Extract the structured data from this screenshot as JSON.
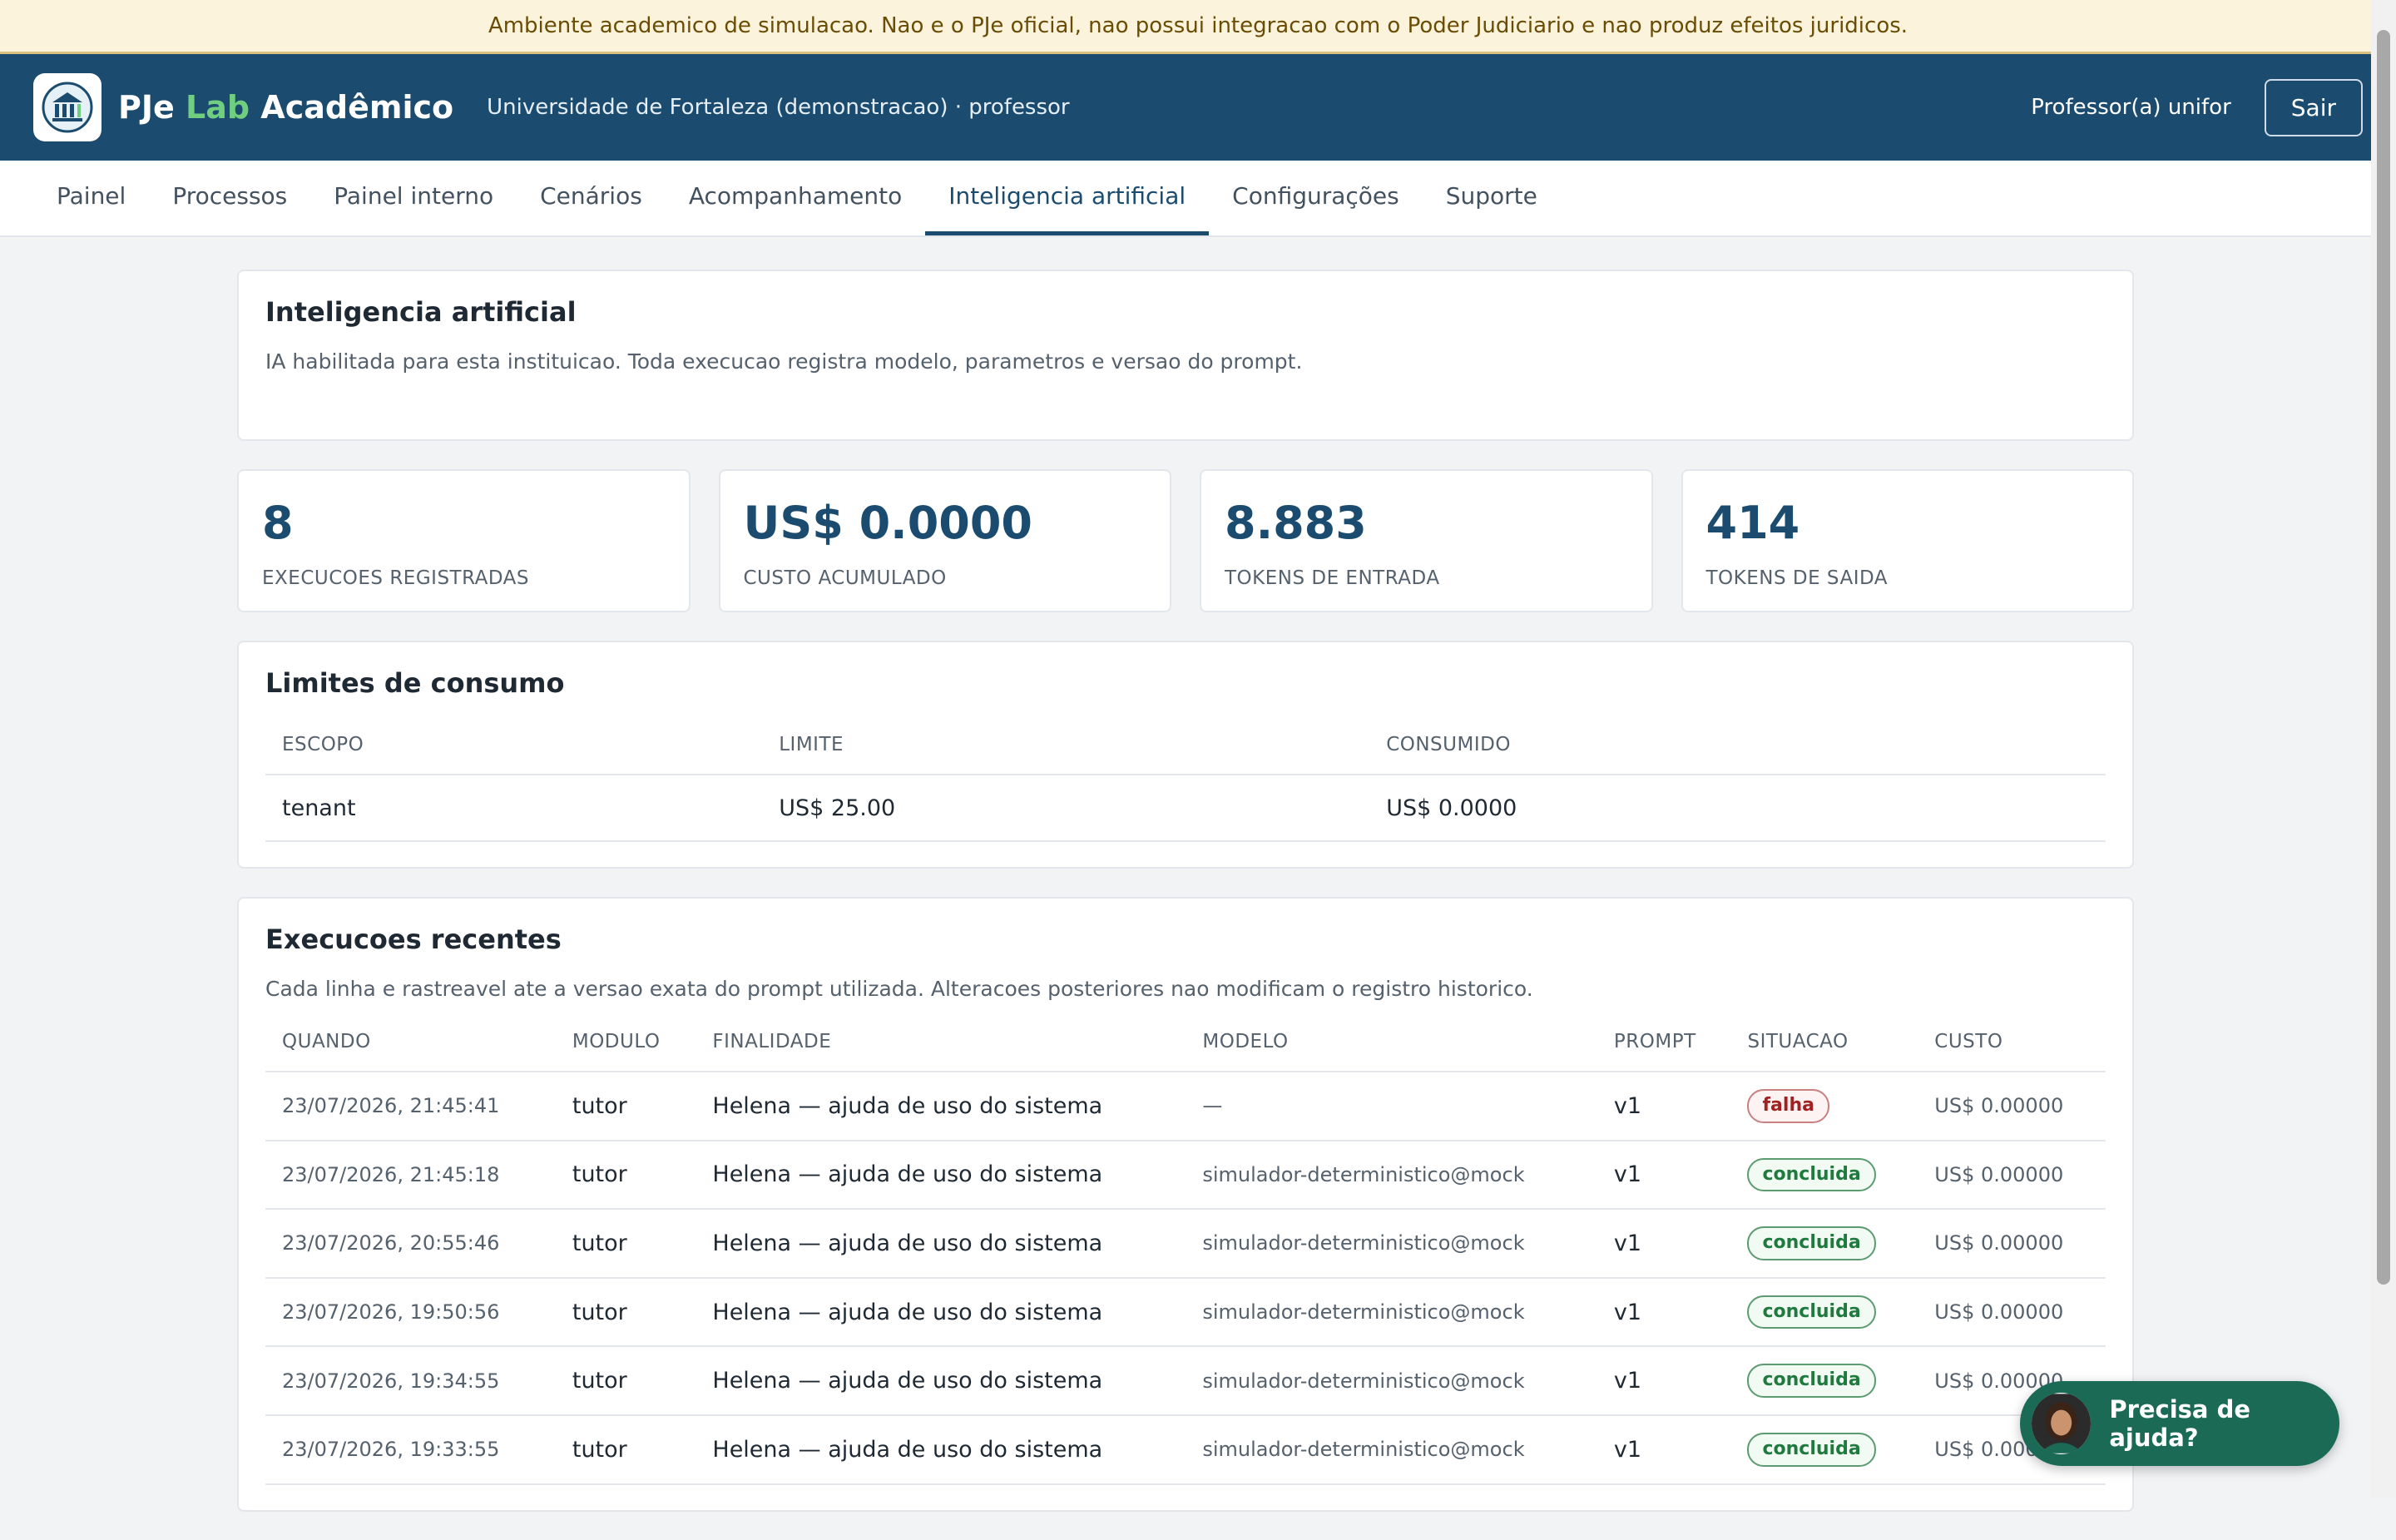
{
  "banner": {
    "text": "Ambiente academico de simulacao. Nao e o PJe oficial, nao possui integracao com o Poder Judiciario e nao produz efeitos juridicos."
  },
  "header": {
    "brand_prefix": "PJe ",
    "brand_lab": "Lab",
    "brand_suffix": " Acadêmico",
    "institution": "Universidade de Fortaleza (demonstracao) · professor",
    "user": "Professor(a) unifor",
    "logout_label": "Sair",
    "logo_icon": "institution-building-icon"
  },
  "nav": {
    "tabs": [
      {
        "label": "Painel"
      },
      {
        "label": "Processos"
      },
      {
        "label": "Painel interno"
      },
      {
        "label": "Cenários"
      },
      {
        "label": "Acompanhamento"
      },
      {
        "label": "Inteligencia artificial",
        "active": true
      },
      {
        "label": "Configurações"
      },
      {
        "label": "Suporte"
      }
    ]
  },
  "intro": {
    "title": "Inteligencia artificial",
    "description": "IA habilitada para esta instituicao. Toda execucao registra modelo, parametros e versao do prompt."
  },
  "stats": [
    {
      "value": "8",
      "label": "Execucoes registradas"
    },
    {
      "value": "US$ 0.0000",
      "label": "Custo acumulado"
    },
    {
      "value": "8.883",
      "label": "Tokens de entrada"
    },
    {
      "value": "414",
      "label": "Tokens de saida"
    }
  ],
  "limits": {
    "title": "Limites de consumo",
    "headers": [
      "ESCOPO",
      "LIMITE",
      "CONSUMIDO"
    ],
    "rows": [
      [
        "tenant",
        "US$ 25.00",
        "US$ 0.0000"
      ]
    ]
  },
  "executions": {
    "title": "Execucoes recentes",
    "description": "Cada linha e rastreavel ate a versao exata do prompt utilizada. Alteracoes posteriores nao modificam o registro historico.",
    "headers": [
      "QUANDO",
      "MODULO",
      "FINALIDADE",
      "MODELO",
      "PROMPT",
      "SITUACAO",
      "CUSTO"
    ],
    "rows": [
      {
        "when": "23/07/2026, 21:45:41",
        "module": "tutor",
        "purpose": "Helena — ajuda de uso do sistema",
        "model": "—",
        "prompt": "v1",
        "status": "falha",
        "cost": "US$ 0.00000"
      },
      {
        "when": "23/07/2026, 21:45:18",
        "module": "tutor",
        "purpose": "Helena — ajuda de uso do sistema",
        "model": "simulador-deterministico@mock",
        "prompt": "v1",
        "status": "concluida",
        "cost": "US$ 0.00000"
      },
      {
        "when": "23/07/2026, 20:55:46",
        "module": "tutor",
        "purpose": "Helena — ajuda de uso do sistema",
        "model": "simulador-deterministico@mock",
        "prompt": "v1",
        "status": "concluida",
        "cost": "US$ 0.00000"
      },
      {
        "when": "23/07/2026, 19:50:56",
        "module": "tutor",
        "purpose": "Helena — ajuda de uso do sistema",
        "model": "simulador-deterministico@mock",
        "prompt": "v1",
        "status": "concluida",
        "cost": "US$ 0.00000"
      },
      {
        "when": "23/07/2026, 19:34:55",
        "module": "tutor",
        "purpose": "Helena — ajuda de uso do sistema",
        "model": "simulador-deterministico@mock",
        "prompt": "v1",
        "status": "concluida",
        "cost": "US$ 0.00000"
      },
      {
        "when": "23/07/2026, 19:33:55",
        "module": "tutor",
        "purpose": "Helena — ajuda de uso do sistema",
        "model": "simulador-deterministico@mock",
        "prompt": "v1",
        "status": "concluida",
        "cost": "US$ 0.00000"
      }
    ]
  },
  "help": {
    "label": "Precisa de ajuda?",
    "avatar_icon": "assistant-avatar-icon"
  },
  "colors": {
    "header_bg": "#1b4c6f",
    "accent_green": "#6fcf7f",
    "banner_bg": "#fcf3dc",
    "help_bg": "#1b6a56",
    "fail": "#a32020",
    "ok": "#1f7a3e"
  }
}
